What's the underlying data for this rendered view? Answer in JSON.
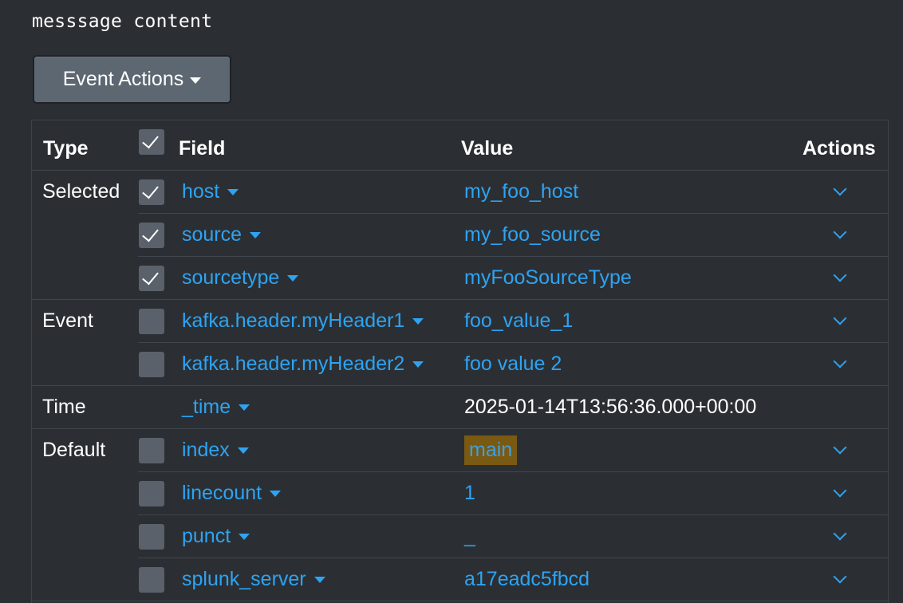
{
  "message": "messsage content",
  "event_actions_label": "Event Actions",
  "headers": {
    "type": "Type",
    "field": "Field",
    "value": "Value",
    "actions": "Actions"
  },
  "groups": {
    "selected": "Selected",
    "event": "Event",
    "time": "Time",
    "default": "Default"
  },
  "rows": [
    {
      "field": "host",
      "value": "my_foo_host",
      "checked": true
    },
    {
      "field": "source",
      "value": "my_foo_source",
      "checked": true
    },
    {
      "field": "sourcetype",
      "value": "myFooSourceType",
      "checked": true
    },
    {
      "field": "kafka.header.myHeader1",
      "value": "foo_value_1",
      "checked": false
    },
    {
      "field": "kafka.header.myHeader2",
      "value": "foo value 2",
      "checked": false
    },
    {
      "field": "_time",
      "value": "2025-01-14T13:56:36.000+00:00"
    },
    {
      "field": "index",
      "value": "main",
      "checked": false,
      "highlighted": true
    },
    {
      "field": "linecount",
      "value": "1",
      "checked": false
    },
    {
      "field": "punct",
      "value": "_",
      "checked": false
    },
    {
      "field": "splunk_server",
      "value": "a17eadc5fbcd",
      "checked": false
    }
  ],
  "colors": {
    "background": "#2b2f33",
    "link": "#2ea3f2",
    "highlight": "#7a5a12",
    "button": "#5d6772"
  },
  "icons": {
    "dropdown": "caret-down-icon",
    "expand": "chevron-down-icon",
    "check": "checkmark-icon"
  }
}
